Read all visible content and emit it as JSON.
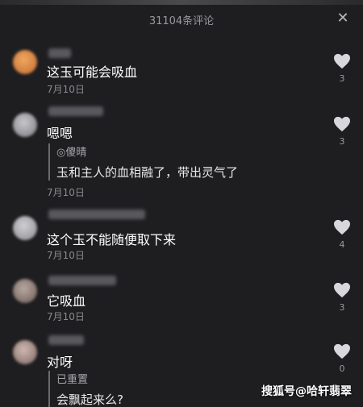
{
  "header": {
    "title": "31104条评论",
    "close_icon": "close-icon"
  },
  "comments": [
    {
      "text": "这玉可能会吸血",
      "date": "7月10日",
      "likes": "3",
      "avatar_color": "#d98a4a"
    },
    {
      "text": "嗯嗯",
      "date": "7月10日",
      "likes": "3",
      "avatar_color": "#9c9ca0",
      "quote": {
        "author": "◎傻晴",
        "text": "玉和主人的血相融了，带出灵气了"
      }
    },
    {
      "text": "这个玉不能随便取下来",
      "date": "7月10日",
      "likes": "4",
      "avatar_color": "#a8a8ac"
    },
    {
      "text": "它吸血",
      "date": "7月10日",
      "likes": "3",
      "avatar_color": "#8a7a74"
    },
    {
      "text": "对呀",
      "likes": "0",
      "avatar_color": "#b09a94",
      "quote": {
        "author": "已重置",
        "text": "会飘起来么?"
      }
    }
  ],
  "watermark": "搜狐号@哈轩翡翠"
}
